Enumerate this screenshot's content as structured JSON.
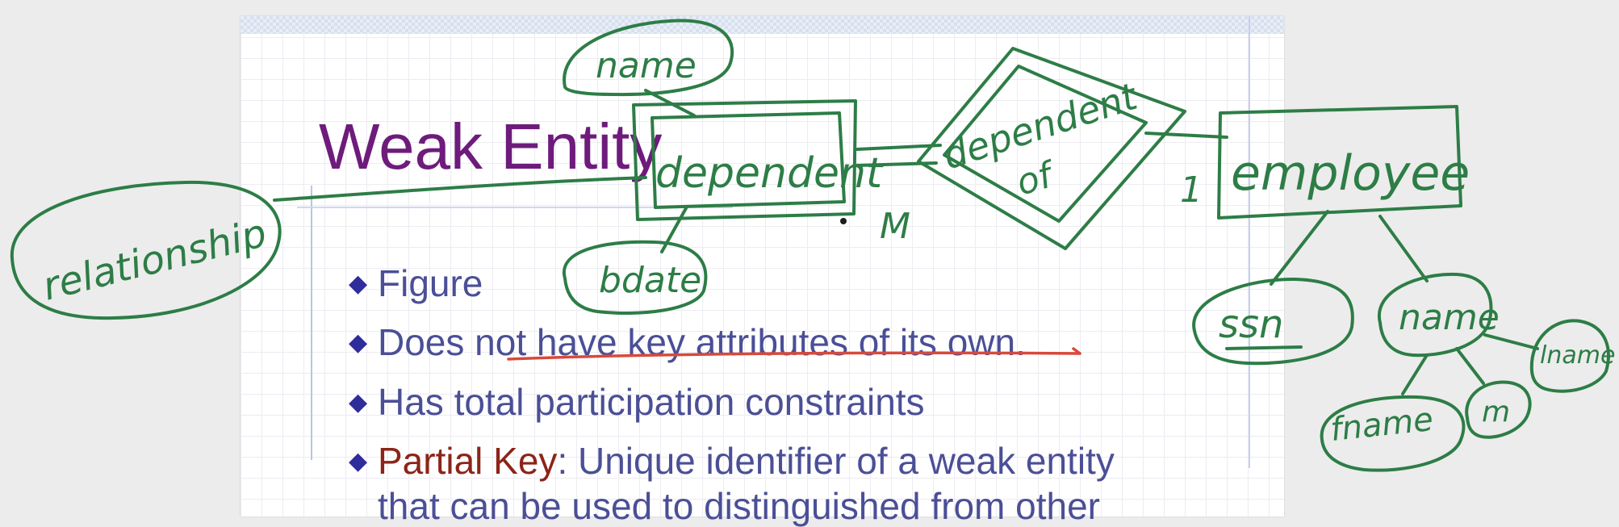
{
  "slide": {
    "title": "Weak Entity",
    "bullets": [
      {
        "text": "Figure"
      },
      {
        "text": "Does not have key attributes of its own."
      },
      {
        "text": "Has total participation constraints"
      },
      {
        "key": "Partial Key",
        "text": ": Unique identifier of a weak entity"
      },
      {
        "text": "that can be used to distinguished from other"
      }
    ]
  },
  "annotations": {
    "name": "name",
    "dependent": "dependent",
    "dependent_of_line1": "dependent",
    "dependent_of_line2": "of",
    "employee": "employee",
    "cardinality_m": "M",
    "cardinality_1": "1",
    "bdate": "bdate",
    "relationship": "relationship",
    "ssn": "ssn",
    "emp_name": "name",
    "fname": "fname",
    "m": "m",
    "lname": "lname"
  },
  "colors": {
    "ink": "#2d7d46",
    "underline": "#d8493a",
    "title": "#6e1b7c",
    "bullet_text": "#4b4f96",
    "partial_key": "#8c2418"
  }
}
